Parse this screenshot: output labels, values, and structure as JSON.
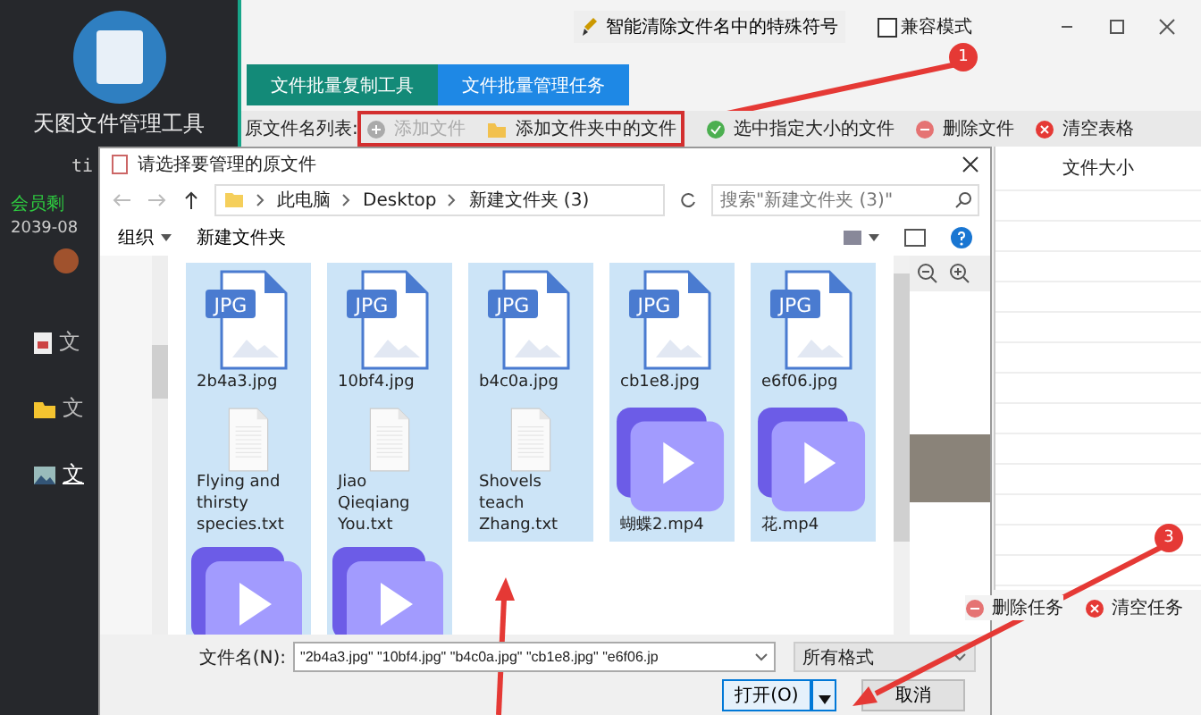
{
  "sidebar": {
    "app_title": "天图文件管理工具",
    "user_id": "ti",
    "member_label": "会员剩",
    "expiry": "2039-08",
    "nav_items": [
      {
        "label": "文",
        "kind": "doc",
        "selected": false
      },
      {
        "label": "文",
        "kind": "folder",
        "selected": false
      },
      {
        "label": "文",
        "kind": "image",
        "selected": true
      }
    ]
  },
  "topbar": {
    "clean_button": "智能清除文件名中的特殊符号",
    "compat_mode": {
      "label": "兼容模式",
      "checked": false
    }
  },
  "tabs": [
    {
      "label": "文件批量复制工具",
      "color": "#138a78"
    },
    {
      "label": "文件批量管理任务",
      "color": "#1e88e5"
    }
  ],
  "toolbar": {
    "label": "原文件名列表:",
    "actions": [
      {
        "label": "添加文件",
        "kind": "add",
        "disabled": true
      },
      {
        "label": "添加文件夹中的文件",
        "kind": "folder",
        "disabled": false
      },
      {
        "label": "选中指定大小的文件",
        "kind": "check",
        "disabled": false
      },
      {
        "label": "删除文件",
        "kind": "remove",
        "disabled": false
      },
      {
        "label": "清空表格",
        "kind": "clear",
        "disabled": false
      }
    ]
  },
  "table": {
    "columns": [
      "文件大小"
    ]
  },
  "task_toolbar": {
    "actions": [
      {
        "label": "删除任务",
        "kind": "remove"
      },
      {
        "label": "清空任务",
        "kind": "clear"
      }
    ]
  },
  "dialog": {
    "title": "请选择要管理的原文件",
    "breadcrumb": [
      "此电脑",
      "Desktop",
      "新建文件夹 (3)"
    ],
    "search": {
      "placeholder": "搜索\"新建文件夹 (3)\""
    },
    "commands": [
      {
        "label": "组织",
        "has_menu": true
      },
      {
        "label": "新建文件夹",
        "has_menu": false
      }
    ],
    "files": [
      {
        "name": "2b4a3.jpg",
        "kind": "jpg",
        "badge": "JPG",
        "selected": true
      },
      {
        "name": "10bf4.jpg",
        "kind": "jpg",
        "badge": "JPG",
        "selected": true
      },
      {
        "name": "b4c0a.jpg",
        "kind": "jpg",
        "badge": "JPG",
        "selected": true
      },
      {
        "name": "cb1e8.jpg",
        "kind": "jpg",
        "badge": "JPG",
        "selected": true
      },
      {
        "name": "e6f06.jpg",
        "kind": "jpg",
        "badge": "JPG",
        "selected": true
      },
      {
        "name": "Flying and thirsty species.txt",
        "kind": "txt",
        "selected": true
      },
      {
        "name": "Jiao Qieqiang You.txt",
        "kind": "txt",
        "selected": true
      },
      {
        "name": "Shovels teach Zhang.txt",
        "kind": "txt",
        "selected": true
      },
      {
        "name": "蝴蝶2.mp4",
        "kind": "video",
        "selected": true
      },
      {
        "name": "花.mp4",
        "kind": "video",
        "selected": true
      },
      {
        "kind": "video",
        "selected": true
      },
      {
        "kind": "video",
        "selected": true
      }
    ],
    "file_name": {
      "label": "文件名(N):",
      "value": "\"2b4a3.jpg\" \"10bf4.jpg\" \"b4c0a.jpg\" \"cb1e8.jpg\" \"e6f06.jp"
    },
    "file_type": "所有格式",
    "open_button": "打开(O)",
    "cancel_button": "取消"
  },
  "annotations": [
    {
      "number": "1"
    },
    {
      "number": "3"
    }
  ]
}
